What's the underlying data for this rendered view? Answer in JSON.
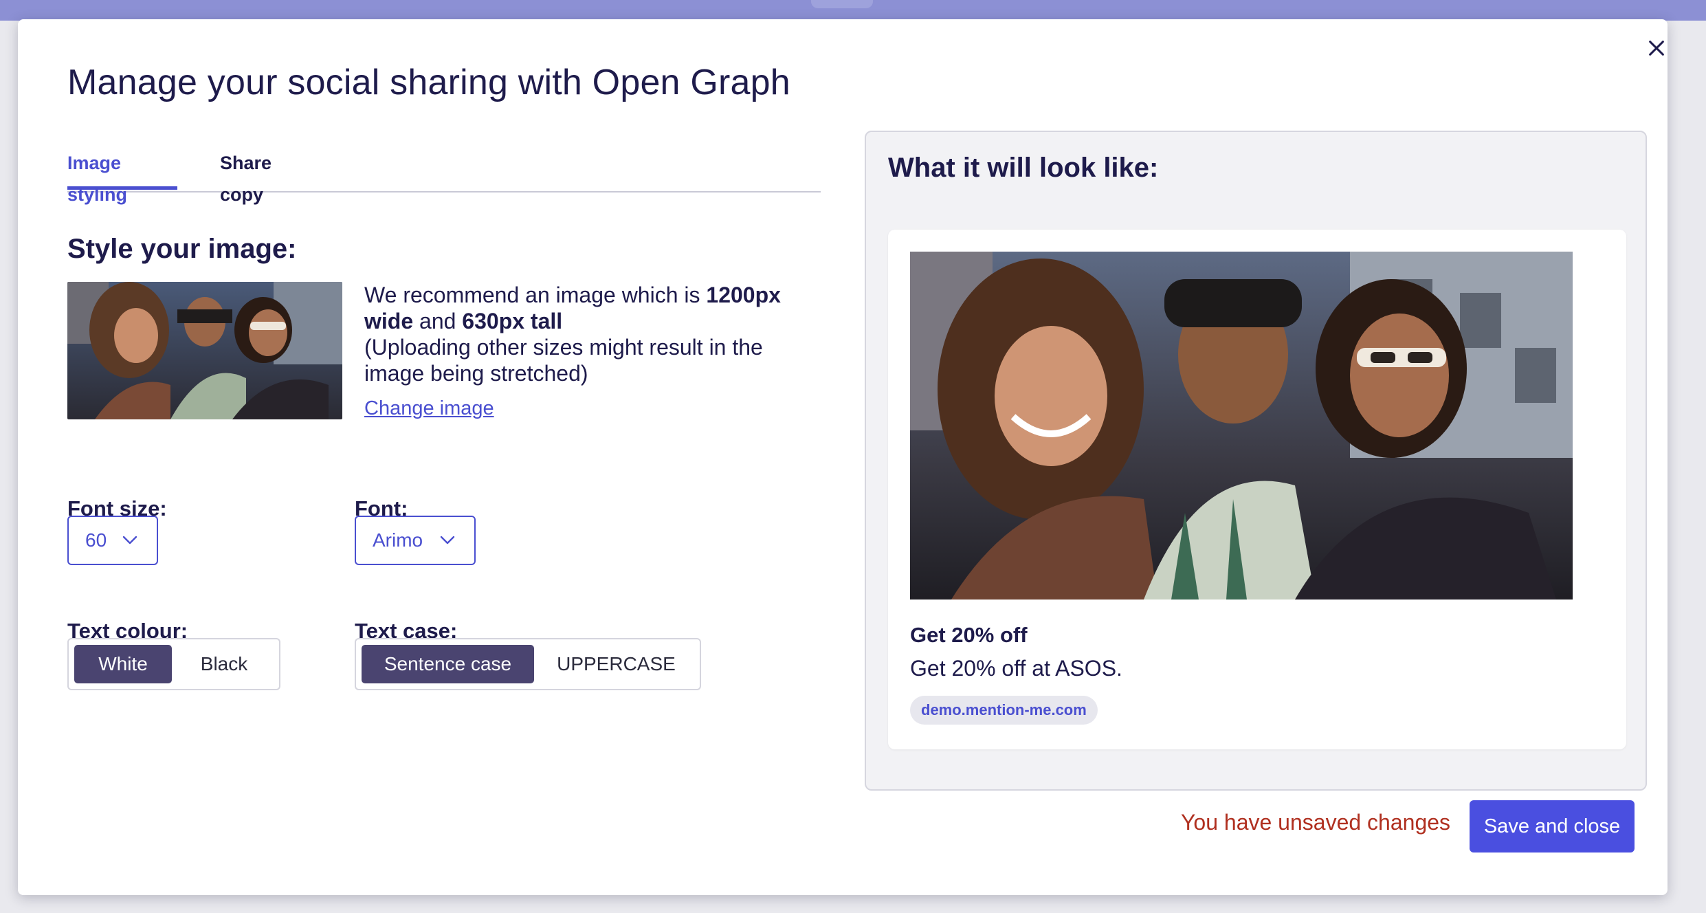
{
  "modal": {
    "title": "Manage your social sharing with Open Graph",
    "close_icon": "close-icon"
  },
  "tabs": [
    {
      "label": "Image styling",
      "active": true
    },
    {
      "label": "Share copy",
      "active": false
    }
  ],
  "style_section": {
    "title": "Style your image:",
    "recommend": {
      "part1": "We recommend an image which is ",
      "bold1": "1200px wide",
      "part2": " and ",
      "bold2": "630px tall",
      "part3": "(Uploading other sizes might result in the image being stretched)"
    },
    "change_image_label": "Change image",
    "font_size": {
      "label": "Font size:",
      "value": "60"
    },
    "font": {
      "label": "Font:",
      "value": "Arimo"
    },
    "text_colour": {
      "label": "Text colour:",
      "options": [
        "White",
        "Black"
      ],
      "selected": "White"
    },
    "text_case": {
      "label": "Text case:",
      "options": [
        "Sentence case",
        "UPPERCASE"
      ],
      "selected": "Sentence case"
    }
  },
  "preview": {
    "heading": "What it will look like:",
    "card": {
      "title": "Get 20% off",
      "description": "Get 20% off at ASOS.",
      "domain": "demo.mention-me.com"
    }
  },
  "footer": {
    "unsaved_text": "You have unsaved changes",
    "save_label": "Save and close"
  },
  "colors": {
    "accent": "#4a4fd0",
    "selected_segment": "#4a4470",
    "warning": "#b03020",
    "heading": "#1e1b4b"
  }
}
